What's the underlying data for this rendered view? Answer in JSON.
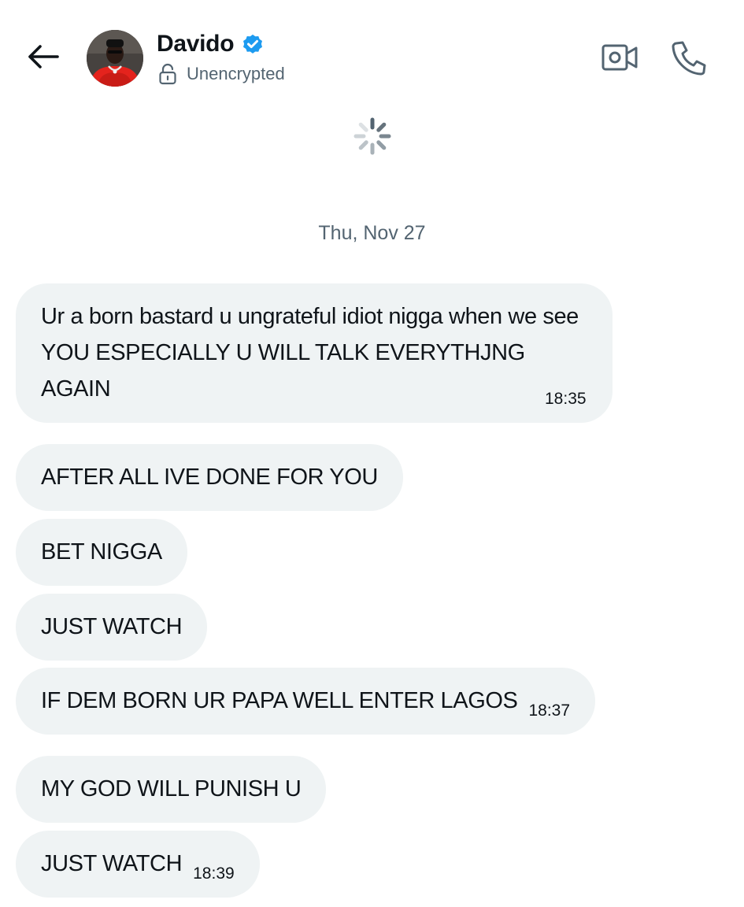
{
  "header": {
    "back_icon": "arrow-left-icon",
    "contact_name": "Davido",
    "verified_icon": "verified-badge-icon",
    "verified_color": "#1d9bf0",
    "lock_icon": "unlocked-padlock-icon",
    "encryption_status": "Unencrypted",
    "video_call_icon": "video-camera-icon",
    "phone_call_icon": "phone-icon"
  },
  "loading_icon": "spinner-icon",
  "date_separator": "Thu, Nov 27",
  "messages": [
    {
      "text": "Ur a born bastard u ungrateful idiot nigga when we see YOU ESPECIALLY U WILL TALK EVERYTHJNG AGAIN",
      "time": "18:35"
    },
    {
      "text": "AFTER ALL IVE DONE FOR YOU",
      "time": ""
    },
    {
      "text": "BET NIGGA",
      "time": ""
    },
    {
      "text": "JUST WATCH",
      "time": ""
    },
    {
      "text": "IF DEM BORN UR PAPA WELL ENTER LAGOS",
      "time": "18:37"
    },
    {
      "text": "MY GOD WILL PUNISH U",
      "time": ""
    },
    {
      "text": "JUST WATCH",
      "time": "18:39"
    }
  ],
  "colors": {
    "bubble_background": "#eff3f4",
    "secondary_text": "#536471",
    "primary_text": "#0f1419"
  }
}
